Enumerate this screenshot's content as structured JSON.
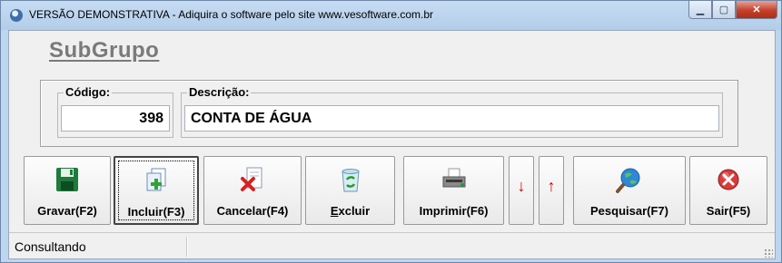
{
  "window": {
    "title": "VERSÃO DEMONSTRATIVA - Adiquira o software pelo site www.vesoftware.com.br",
    "controls": {
      "minimize": "▁",
      "maximize": "▢",
      "close": "✕"
    }
  },
  "form": {
    "heading": "SubGrupo",
    "codigo": {
      "label": "Código:",
      "value": "398"
    },
    "descricao": {
      "label": "Descrição:",
      "value": "CONTA DE ÁGUA"
    }
  },
  "toolbar": {
    "gravar": "Gravar(F2)",
    "incluir": "Incluir(F3)",
    "cancelar": "Cancelar(F4)",
    "excluir_prefix": "E",
    "excluir_rest": "xcluir",
    "imprimir": "Imprimir(F6)",
    "down": "↓",
    "up": "↑",
    "pesquisar": "Pesquisar(F7)",
    "sair": "Sair(F5)"
  },
  "status": {
    "text": "Consultando"
  },
  "colors": {
    "title_bg": "#bdd6f0",
    "client_bg": "#f0f0f0",
    "heading": "#7a7a7a",
    "arrow_red": "#d10000"
  }
}
